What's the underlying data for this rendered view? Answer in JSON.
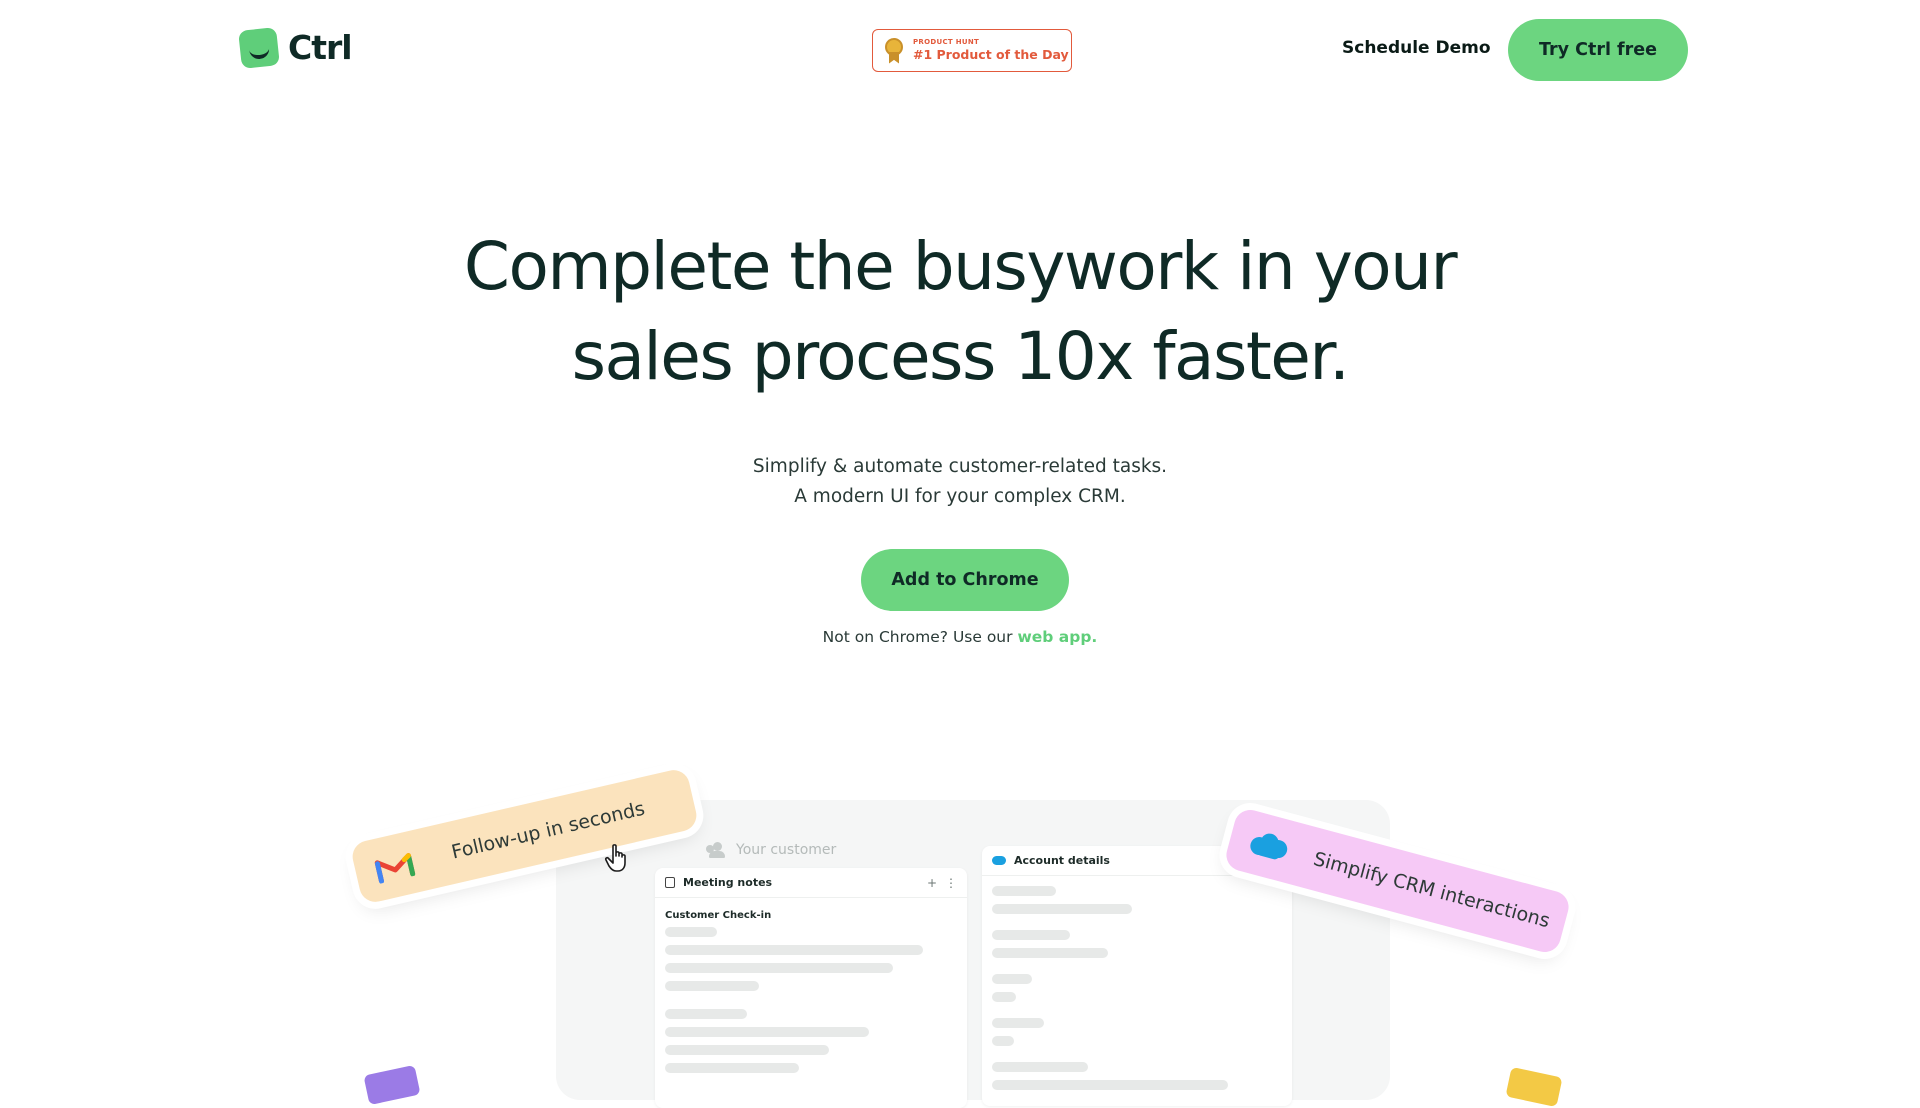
{
  "header": {
    "logo_text": "Ctrl",
    "badge": {
      "small": "PRODUCT HUNT",
      "big": "#1 Product of the Day"
    },
    "schedule_label": "Schedule Demo",
    "try_label": "Try Ctrl free"
  },
  "hero": {
    "title_line1": "Complete the busywork in your",
    "title_line2": "sales process 10x faster.",
    "sub_line1": "Simplify & automate customer-related tasks.",
    "sub_line2": "A modern UI for your complex CRM.",
    "cta_label": "Add to Chrome",
    "alt_prefix": "Not on Chrome? Use our ",
    "alt_link": "web app."
  },
  "mock": {
    "customer_label": "Your customer",
    "notes_title": "Meeting notes",
    "notes_add": "+",
    "notes_more": "⋮",
    "notes_subtitle": "Customer Check-in",
    "account_title": "Account details"
  },
  "tags": {
    "follow": "Follow-up in seconds",
    "crm": "Simplify CRM interactions"
  },
  "colors": {
    "brand_green": "#6cd580",
    "text_dark": "#0f2a26",
    "badge_red": "#e25a3c",
    "follow_tag_bg": "#fbe3bd",
    "crm_tag_bg": "#f6c9f6"
  },
  "icons": {
    "logo": "ctrl-logo-icon",
    "medal": "medal-icon",
    "gmail": "gmail-icon",
    "salesforce": "salesforce-cloud-icon",
    "cursor": "hand-cursor-icon",
    "people": "people-icon",
    "doc": "document-icon"
  }
}
